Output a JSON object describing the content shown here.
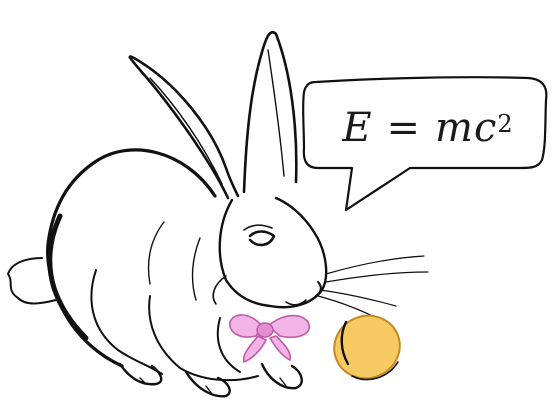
{
  "speech_bubble": {
    "lhs": "E",
    "operator": "=",
    "rhs_base": "mc",
    "rhs_exponent": "2"
  },
  "colors": {
    "outline": "#111111",
    "bow_fill": "#f2b4e6",
    "bow_stroke": "#c25aa8",
    "egg_fill": "#f7c962",
    "egg_stroke": "#c58a1e"
  }
}
